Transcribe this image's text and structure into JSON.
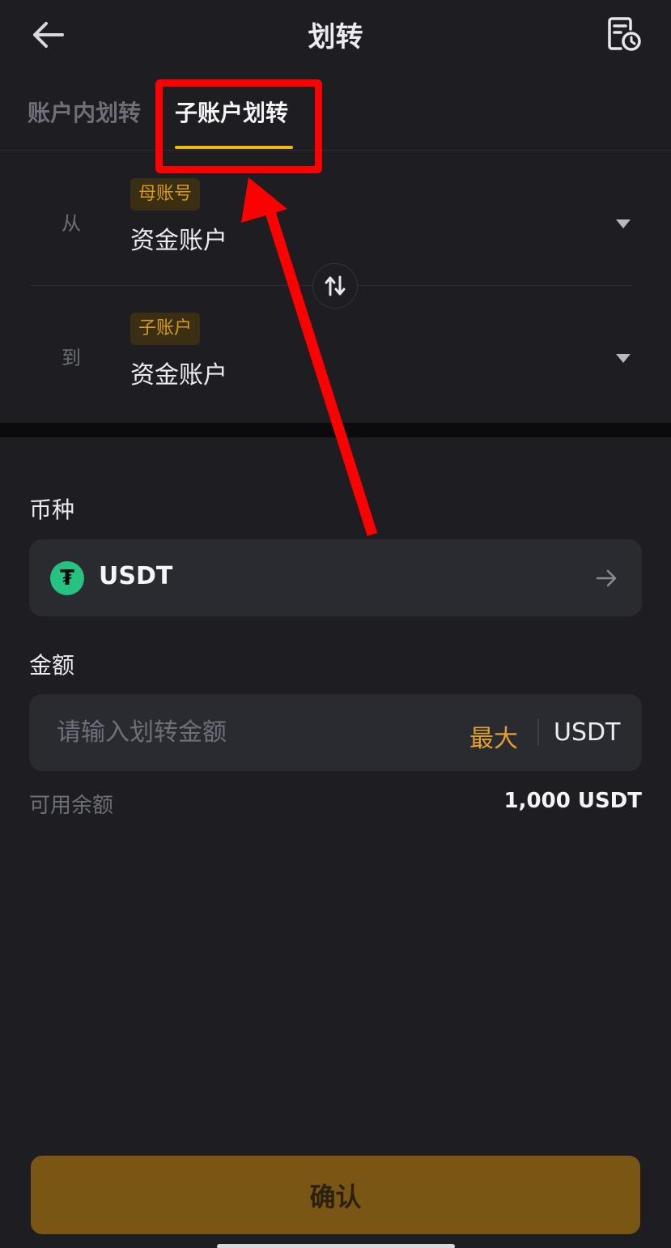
{
  "header": {
    "title": "划转"
  },
  "tabs": [
    {
      "label": "账户内划转",
      "active": false
    },
    {
      "label": "子账户划转",
      "active": true
    }
  ],
  "transfer": {
    "from": {
      "direction_label": "从",
      "badge": "母账号",
      "account": "资金账户"
    },
    "to": {
      "direction_label": "到",
      "badge": "子账户",
      "account": "资金账户"
    }
  },
  "coin": {
    "label": "币种",
    "selected": "USDT",
    "icon_glyph": "₮"
  },
  "amount": {
    "label": "金额",
    "placeholder": "请输入划转金额",
    "max_label": "最大",
    "unit": "USDT"
  },
  "balance": {
    "label": "可用余额",
    "value": "1,000 USDT"
  },
  "confirm_label": "确认",
  "colors": {
    "background": "#1d1d22",
    "accent": "#f0b90b",
    "badge_text": "#d79b1d",
    "confirm_bg": "#7a5614",
    "annotation": "#ff0000"
  }
}
